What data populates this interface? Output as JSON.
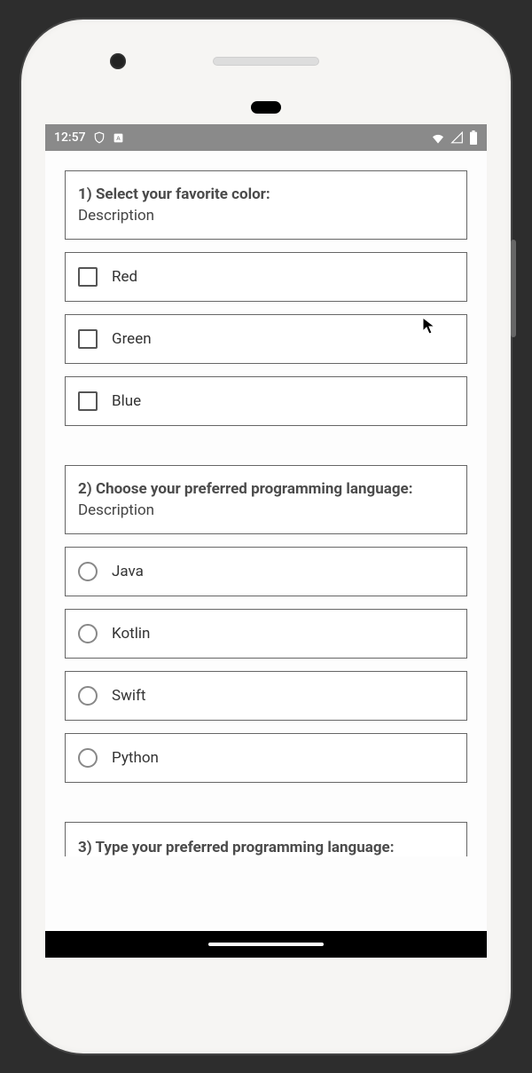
{
  "status": {
    "time": "12:57",
    "icons_left": [
      "shield-icon",
      "keyboard-lang-icon"
    ],
    "icons_right": [
      "wifi-icon",
      "signal-icon",
      "battery-icon"
    ]
  },
  "questions": [
    {
      "title": "1) Select your favorite color:",
      "description": "Description",
      "type": "checkbox",
      "options": [
        "Red",
        "Green",
        "Blue"
      ]
    },
    {
      "title": "2) Choose your preferred programming language:",
      "description": "Description",
      "type": "radio",
      "options": [
        "Java",
        "Kotlin",
        "Swift",
        "Python"
      ]
    },
    {
      "title": "3) Type your preferred programming language:",
      "description": "",
      "type": "text",
      "options": []
    }
  ]
}
